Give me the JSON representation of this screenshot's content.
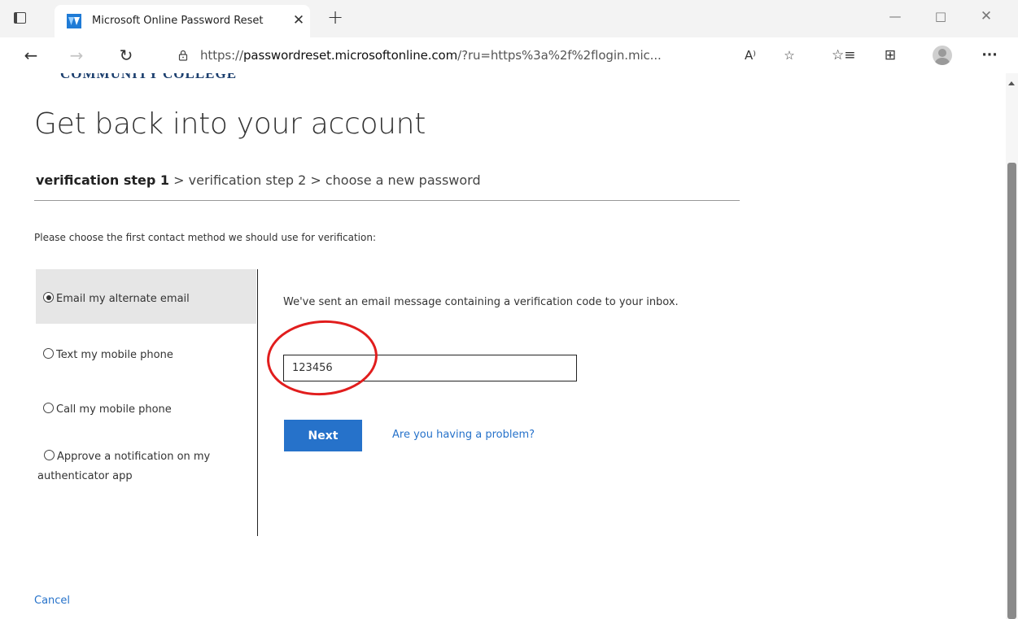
{
  "browser": {
    "tab_title": "Microsoft Online Password Reset",
    "tab_close": "✕",
    "new_tab": "+",
    "url_prefix": "https://",
    "url_host": "passwordreset.microsoftonline.com",
    "url_rest": "/?ru=https%3a%2f%2flogin.mic...",
    "read_aloud": "A⁾",
    "more": "···"
  },
  "page": {
    "logo_text": "COMMUNITY COLLEGE",
    "title": "Get back into your account",
    "steps": {
      "current": "verification step 1",
      "sep1": " > ",
      "step2": "verification step 2",
      "sep2": " > ",
      "step3": "choose a new password"
    },
    "instruction": "Please choose the first contact method we should use for verification:",
    "options": [
      {
        "label": "Email my alternate email",
        "selected": true
      },
      {
        "label": "Text my mobile phone",
        "selected": false
      },
      {
        "label": "Call my mobile phone",
        "selected": false
      },
      {
        "label": "Approve a notification on my authenticator app",
        "selected": false
      }
    ],
    "sent_message": "We've sent an email message containing a verification code to your inbox.",
    "code_value": "123456",
    "next_label": "Next",
    "problem_link": "Are you having a problem?",
    "cancel_label": "Cancel"
  },
  "colors": {
    "accent": "#2672ca",
    "annotation": "#e11d1d",
    "selected_bg": "#e6e6e6"
  }
}
